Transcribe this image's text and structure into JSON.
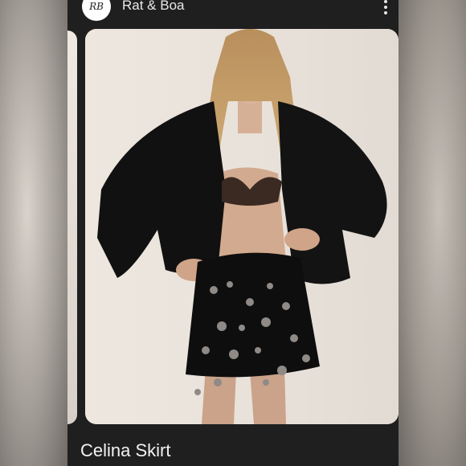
{
  "shop": {
    "name": "Rat & Boa",
    "logo_text": "RB"
  },
  "product": {
    "title": "Celina Skirt"
  },
  "icons": {
    "menu": "kebab-menu-icon",
    "logo": "brand-logo-icon"
  },
  "colors": {
    "app_bg": "#1f1f1f",
    "text": "#f2f2f2",
    "photo_bg": "#e7e0d8"
  }
}
